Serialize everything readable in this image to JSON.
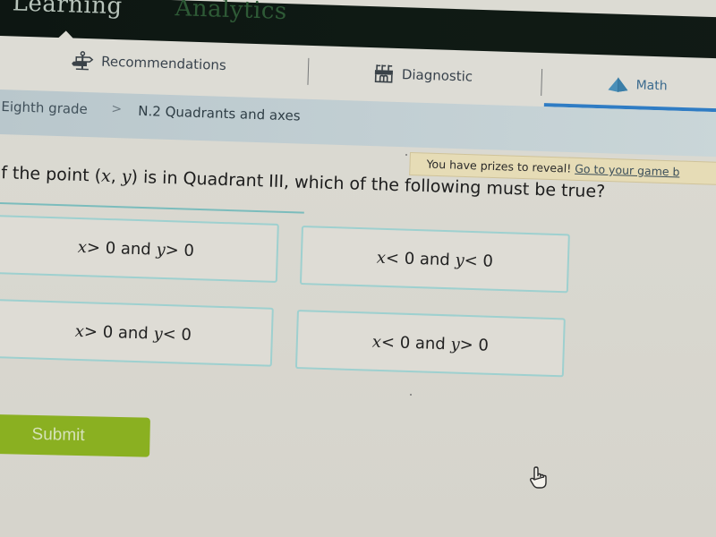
{
  "top_nav": {
    "items": [
      {
        "label": "Learning",
        "active": true
      },
      {
        "label": "Analytics",
        "active": false
      }
    ]
  },
  "sub_nav": {
    "tabs": [
      {
        "label": "Recommendations",
        "icon": "signpost-icon",
        "active": false
      },
      {
        "label": "Diagnostic",
        "icon": "diagnostic-icon",
        "active": false
      },
      {
        "label": "Math",
        "icon": "pyramid-icon",
        "active": true
      }
    ],
    "accent_color": "#2f7cc4"
  },
  "breadcrumb": {
    "items": [
      "Eighth grade",
      "N.2 Quadrants and axes"
    ],
    "separator": ">"
  },
  "prize_banner": {
    "text": "You have prizes to reveal!",
    "link": "Go to your game b"
  },
  "question": {
    "prefix": "If the point (",
    "var_x": "x",
    "comma": ", ",
    "var_y": "y",
    "suffix": ") is in Quadrant III, which of the following must be true?"
  },
  "choices": [
    {
      "x": "x",
      "op1": " > 0 and ",
      "y": "y",
      "op2": " > 0"
    },
    {
      "x": "x",
      "op1": " < 0 and ",
      "y": "y",
      "op2": " < 0"
    },
    {
      "x": "x",
      "op1": " > 0 and ",
      "y": "y",
      "op2": " < 0"
    },
    {
      "x": "x",
      "op1": " < 0 and ",
      "y": "y",
      "op2": " > 0"
    }
  ],
  "submit": {
    "label": "Submit",
    "color": "#8ab021"
  }
}
